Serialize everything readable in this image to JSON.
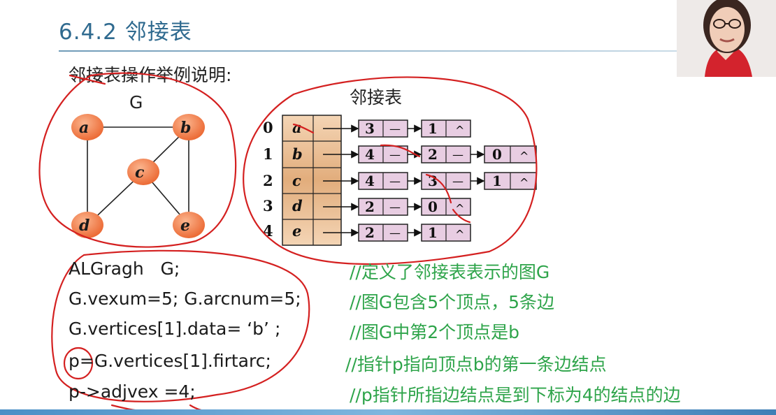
{
  "slide": {
    "title": "6.4.2 邻接表",
    "subtitle": "邻接表操作举例说明:"
  },
  "graph": {
    "label": "G",
    "vertices": [
      "a",
      "b",
      "c",
      "d",
      "e"
    ],
    "edges": [
      [
        "a",
        "b"
      ],
      [
        "a",
        "d"
      ],
      [
        "b",
        "c"
      ],
      [
        "b",
        "e"
      ],
      [
        "c",
        "d"
      ],
      [
        "c",
        "e"
      ]
    ],
    "node_color": "#f07a48"
  },
  "adjacency_list": {
    "label": "邻接表",
    "indices": [
      "0",
      "1",
      "2",
      "3",
      "4"
    ],
    "rows": [
      {
        "vertex": "a",
        "nodes": [
          "3",
          "1"
        ]
      },
      {
        "vertex": "b",
        "nodes": [
          "4",
          "2",
          "0"
        ]
      },
      {
        "vertex": "c",
        "nodes": [
          "4",
          "3",
          "1"
        ]
      },
      {
        "vertex": "d",
        "nodes": [
          "2",
          "0"
        ]
      },
      {
        "vertex": "e",
        "nodes": [
          "2",
          "1"
        ]
      }
    ],
    "null_symbol": "^",
    "link_symbol": "—",
    "cell_color": "#e4c9dc",
    "head_color": "#e6b98a"
  },
  "code": [
    {
      "code": "ALGragh   G;",
      "comment": "//定义了邻接表表示的图G"
    },
    {
      "code": "G.vexum=5; G.arcnum=5;",
      "comment": "//图G包含5个顶点，5条边"
    },
    {
      "code": "G.vertices[1].data= ‘b’ ;",
      "comment": "//图G中第2个顶点是b"
    },
    {
      "code": "p=G.vertices[1].firtarc;",
      "comment": "//指针p指向顶点b的第一条边结点"
    },
    {
      "code": "p->adjvex =4;",
      "comment": "//p指针所指边结点是到下标为4的结点的边"
    }
  ],
  "colors": {
    "title": "#2f6a8f",
    "comment": "#2ea44a",
    "annotation": "#d42020"
  }
}
